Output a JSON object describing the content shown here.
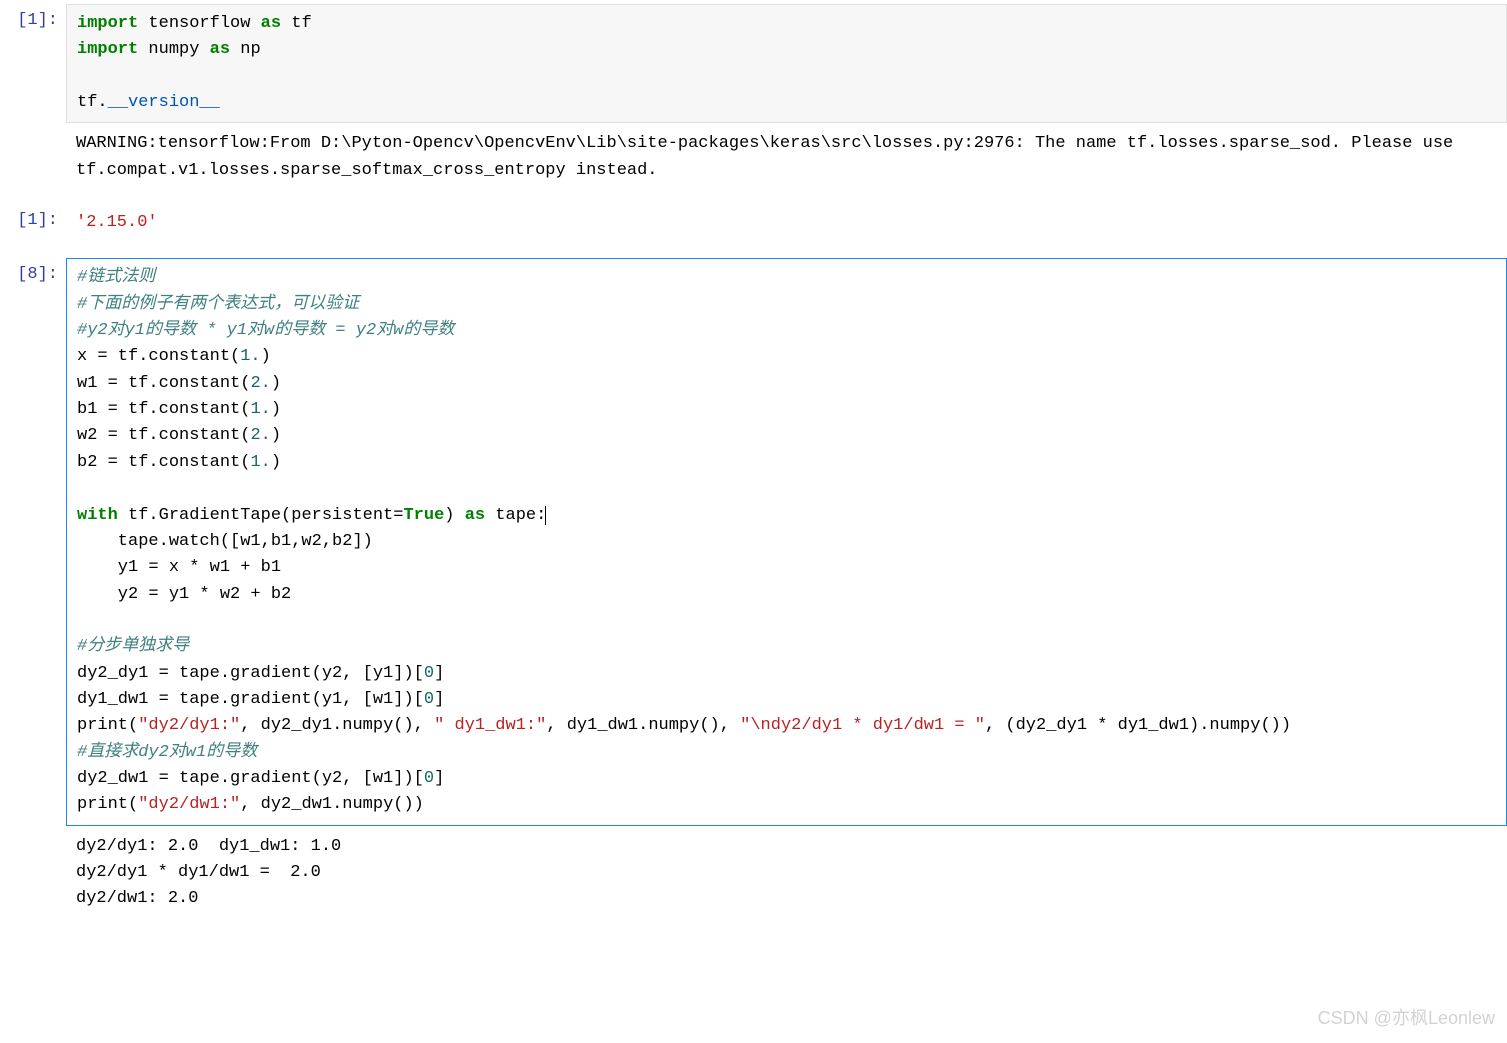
{
  "cells": {
    "c1": {
      "prompt": "[1]:",
      "code": {
        "l1_kw1": "import",
        "l1_mod": " tensorflow ",
        "l1_kw2": "as",
        "l1_alias": " tf",
        "l2_kw1": "import",
        "l2_mod": " numpy ",
        "l2_kw2": "as",
        "l2_alias": " np",
        "l4_obj": "tf.",
        "l4_attr": "__version__"
      }
    },
    "warn": {
      "text": "WARNING:tensorflow:From D:\\Pyton-Opencv\\OpencvEnv\\Lib\\site-packages\\keras\\src\\losses.py:2976: The name tf.losses.sparse_sod. Please use tf.compat.v1.losses.sparse_softmax_cross_entropy instead."
    },
    "out1": {
      "prompt": "[1]:",
      "value": "'2.15.0'"
    },
    "c8": {
      "prompt": "[8]:",
      "code": {
        "l1": "#链式法则",
        "l2": "#下面的例子有两个表达式，可以验证",
        "l3": "#y2对y1的导数 * y1对w的导数 = y2对w的导数",
        "l4_a": "x = tf.constant(",
        "l4_n": "1.",
        "l4_b": ")",
        "l5_a": "w1 = tf.constant(",
        "l5_n": "2.",
        "l5_b": ")",
        "l6_a": "b1 = tf.constant(",
        "l6_n": "1.",
        "l6_b": ")",
        "l7_a": "w2 = tf.constant(",
        "l7_n": "2.",
        "l7_b": ")",
        "l8_a": "b2 = tf.constant(",
        "l8_n": "1.",
        "l8_b": ")",
        "l10_kw": "with",
        "l10_a": " tf.GradientTape(persistent=",
        "l10_t": "True",
        "l10_b": ") ",
        "l10_kw2": "as",
        "l10_c": " tape:",
        "l11": "    tape.watch([w1,b1,w2,b2])",
        "l12": "    y1 = x * w1 + b1",
        "l13": "    y2 = y1 * w2 + b2",
        "l15": "#分步单独求导",
        "l16_a": "dy2_dy1 = tape.gradient(y2, [y1])[",
        "l16_n": "0",
        "l16_b": "]",
        "l17_a": "dy1_dw1 = tape.gradient(y1, [w1])[",
        "l17_n": "0",
        "l17_b": "]",
        "l18_a": "print(",
        "l18_s1": "\"dy2/dy1:\"",
        "l18_b": ", dy2_dy1.numpy(), ",
        "l18_s2": "\" dy1_dw1:\"",
        "l18_c": ", dy1_dw1.numpy(), ",
        "l18_s3": "\"\\ndy2/dy1 * dy1/dw1 = \"",
        "l18_d": ", (dy2_dy1 * dy1_dw1).numpy())",
        "l19": "#直接求dy2对w1的导数",
        "l20_a": "dy2_dw1 = tape.gradient(y2, [w1])[",
        "l20_n": "0",
        "l20_b": "]",
        "l21_a": "print(",
        "l21_s": "\"dy2/dw1:\"",
        "l21_b": ", dy2_dw1.numpy())"
      }
    },
    "out8": {
      "l1": "dy2/dy1: 2.0  dy1_dw1: 1.0",
      "l2": "dy2/dy1 * dy1/dw1 =  2.0",
      "l3": "dy2/dw1: 2.0"
    }
  },
  "watermark": "CSDN @亦枫Leonlew"
}
